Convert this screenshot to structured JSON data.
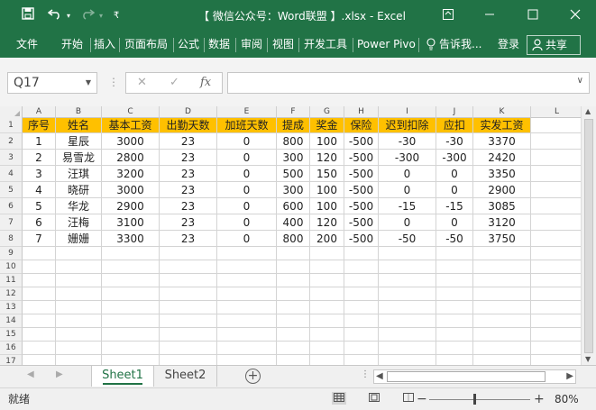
{
  "window": {
    "title": "【 微信公众号：Word联盟 】.xlsx - Excel",
    "save_icon": "save-icon",
    "undo_icon": "undo-icon",
    "redo_icon": "redo-icon"
  },
  "ribbon": {
    "tabs": [
      "文件",
      "开始",
      "插入",
      "页面布局",
      "公式",
      "数据",
      "审阅",
      "视图",
      "开发工具",
      "Power Pivo"
    ],
    "tell_me": "告诉我...",
    "sign_in": "登录",
    "share": "共享"
  },
  "formula_bar": {
    "name_box": "Q17",
    "fx": "fx",
    "formula": ""
  },
  "columns": [
    "A",
    "B",
    "C",
    "D",
    "E",
    "F",
    "G",
    "H",
    "I",
    "J",
    "K",
    "L"
  ],
  "rows": [
    "1",
    "2",
    "3",
    "4",
    "5",
    "6",
    "7",
    "8",
    "9",
    "10",
    "11",
    "12",
    "13",
    "14",
    "15",
    "16",
    "17"
  ],
  "table": {
    "headers": [
      "序号",
      "姓名",
      "基本工资",
      "出勤天数",
      "加班天数",
      "提成",
      "奖金",
      "保险",
      "迟到扣除",
      "应扣",
      "实发工资"
    ],
    "header_color": "#ffc000",
    "data": [
      [
        "1",
        "星辰",
        "3000",
        "23",
        "0",
        "800",
        "100",
        "-500",
        "-30",
        "-30",
        "3370"
      ],
      [
        "2",
        "易雪龙",
        "2800",
        "23",
        "0",
        "300",
        "120",
        "-500",
        "-300",
        "-300",
        "2420"
      ],
      [
        "3",
        "汪琪",
        "3200",
        "23",
        "0",
        "500",
        "150",
        "-500",
        "0",
        "0",
        "3350"
      ],
      [
        "4",
        "晓研",
        "3000",
        "23",
        "0",
        "300",
        "100",
        "-500",
        "0",
        "0",
        "2900"
      ],
      [
        "5",
        "华龙",
        "2900",
        "23",
        "0",
        "600",
        "100",
        "-500",
        "-15",
        "-15",
        "3085"
      ],
      [
        "6",
        "汪梅",
        "3100",
        "23",
        "0",
        "400",
        "120",
        "-500",
        "0",
        "0",
        "3120"
      ],
      [
        "7",
        "姗姗",
        "3300",
        "23",
        "0",
        "800",
        "200",
        "-500",
        "-50",
        "-50",
        "3750"
      ]
    ]
  },
  "sheets": {
    "tabs": [
      "Sheet1",
      "Sheet2"
    ],
    "active": "Sheet1"
  },
  "status": {
    "ready": "就绪",
    "zoom": "80%",
    "zoom_fraction": 0.45
  },
  "theme": {
    "accent": "#217346"
  }
}
